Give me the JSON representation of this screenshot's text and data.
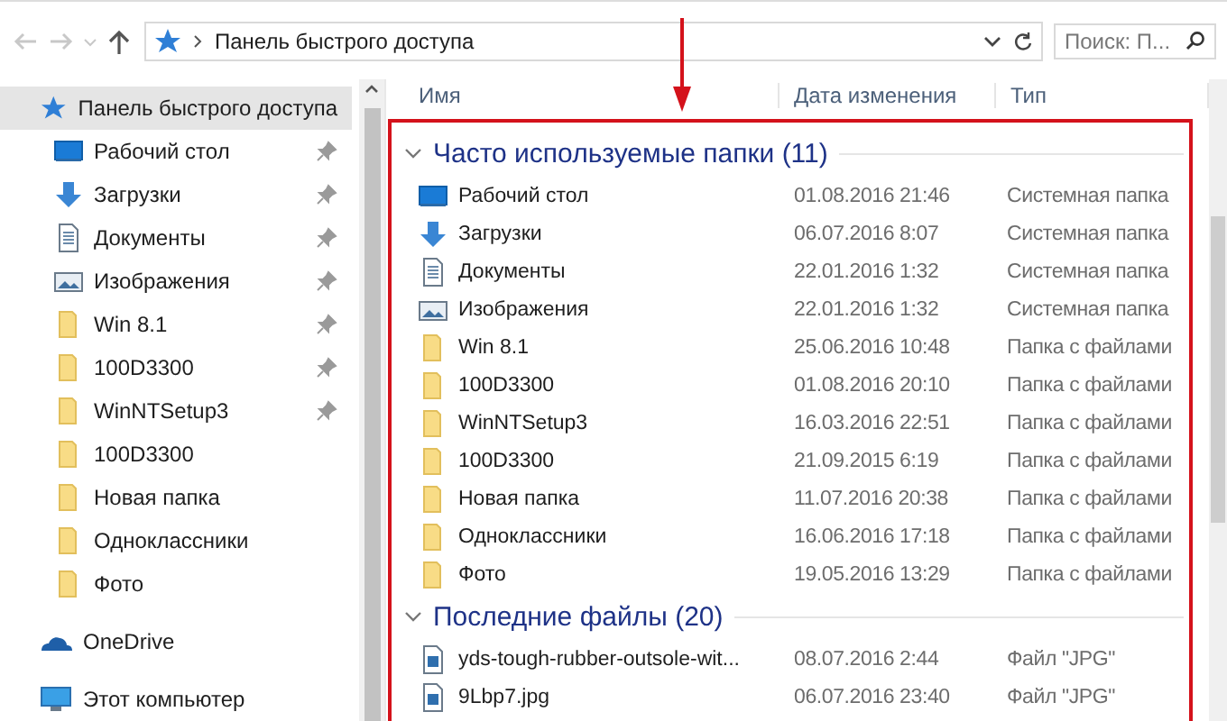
{
  "address": {
    "path": "Панель быстрого доступа"
  },
  "search": {
    "placeholder": "Поиск: П..."
  },
  "sidebar": {
    "sections": [
      {
        "items": [
          {
            "label": "Панель быстрого доступа",
            "kind": "star",
            "pinned": false,
            "selected": true
          },
          {
            "label": "Рабочий стол",
            "kind": "desktop",
            "pinned": true,
            "selected": false
          },
          {
            "label": "Загрузки",
            "kind": "download",
            "pinned": true,
            "selected": false
          },
          {
            "label": "Документы",
            "kind": "document",
            "pinned": true,
            "selected": false
          },
          {
            "label": "Изображения",
            "kind": "pictures",
            "pinned": true,
            "selected": false
          },
          {
            "label": "Win 8.1",
            "kind": "folder",
            "pinned": true,
            "selected": false
          },
          {
            "label": "100D3300",
            "kind": "folder",
            "pinned": true,
            "selected": false
          },
          {
            "label": "WinNTSetup3",
            "kind": "folder",
            "pinned": true,
            "selected": false
          },
          {
            "label": "100D3300",
            "kind": "folder",
            "pinned": false,
            "selected": false
          },
          {
            "label": "Новая папка",
            "kind": "folder",
            "pinned": false,
            "selected": false
          },
          {
            "label": "Одноклассники",
            "kind": "folder",
            "pinned": false,
            "selected": false
          },
          {
            "label": "Фото",
            "kind": "folder",
            "pinned": false,
            "selected": false
          }
        ]
      },
      {
        "items": [
          {
            "label": "OneDrive",
            "kind": "cloud",
            "pinned": false,
            "selected": false
          }
        ]
      },
      {
        "items": [
          {
            "label": "Этот компьютер",
            "kind": "computer",
            "pinned": false,
            "selected": false
          }
        ]
      }
    ]
  },
  "columns": [
    "Имя",
    "Дата изменения",
    "Тип"
  ],
  "groups": [
    {
      "title": "Часто используемые папки (11)",
      "expanded": true,
      "rows": [
        {
          "name": "Рабочий стол",
          "kind": "desktop",
          "date": "01.08.2016 21:46",
          "type": "Системная папка"
        },
        {
          "name": "Загрузки",
          "kind": "download",
          "date": "06.07.2016 8:07",
          "type": "Системная папка"
        },
        {
          "name": "Документы",
          "kind": "document",
          "date": "22.01.2016 1:32",
          "type": "Системная папка"
        },
        {
          "name": "Изображения",
          "kind": "pictures",
          "date": "22.01.2016 1:32",
          "type": "Системная папка"
        },
        {
          "name": "Win 8.1",
          "kind": "folder",
          "date": "25.06.2016 10:48",
          "type": "Папка с файлами"
        },
        {
          "name": "100D3300",
          "kind": "folder",
          "date": "01.08.2016 20:10",
          "type": "Папка с файлами"
        },
        {
          "name": "WinNTSetup3",
          "kind": "folder",
          "date": "16.03.2016 22:51",
          "type": "Папка с файлами"
        },
        {
          "name": "100D3300",
          "kind": "folder",
          "date": "21.09.2015 6:19",
          "type": "Папка с файлами"
        },
        {
          "name": "Новая папка",
          "kind": "folder",
          "date": "11.07.2016 20:38",
          "type": "Папка с файлами"
        },
        {
          "name": "Одноклассники",
          "kind": "folder",
          "date": "16.06.2016 17:18",
          "type": "Папка с файлами"
        },
        {
          "name": "Фото",
          "kind": "folder",
          "date": "19.05.2016 13:29",
          "type": "Папка с файлами"
        }
      ]
    },
    {
      "title": "Последние файлы (20)",
      "expanded": true,
      "rows": [
        {
          "name": "yds-tough-rubber-outsole-wit...",
          "kind": "image-file",
          "date": "08.07.2016 2:44",
          "type": "Файл \"JPG\""
        },
        {
          "name": "9Lbp7.jpg",
          "kind": "image-file",
          "date": "06.07.2016 23:40",
          "type": "Файл \"JPG\""
        }
      ]
    }
  ]
}
